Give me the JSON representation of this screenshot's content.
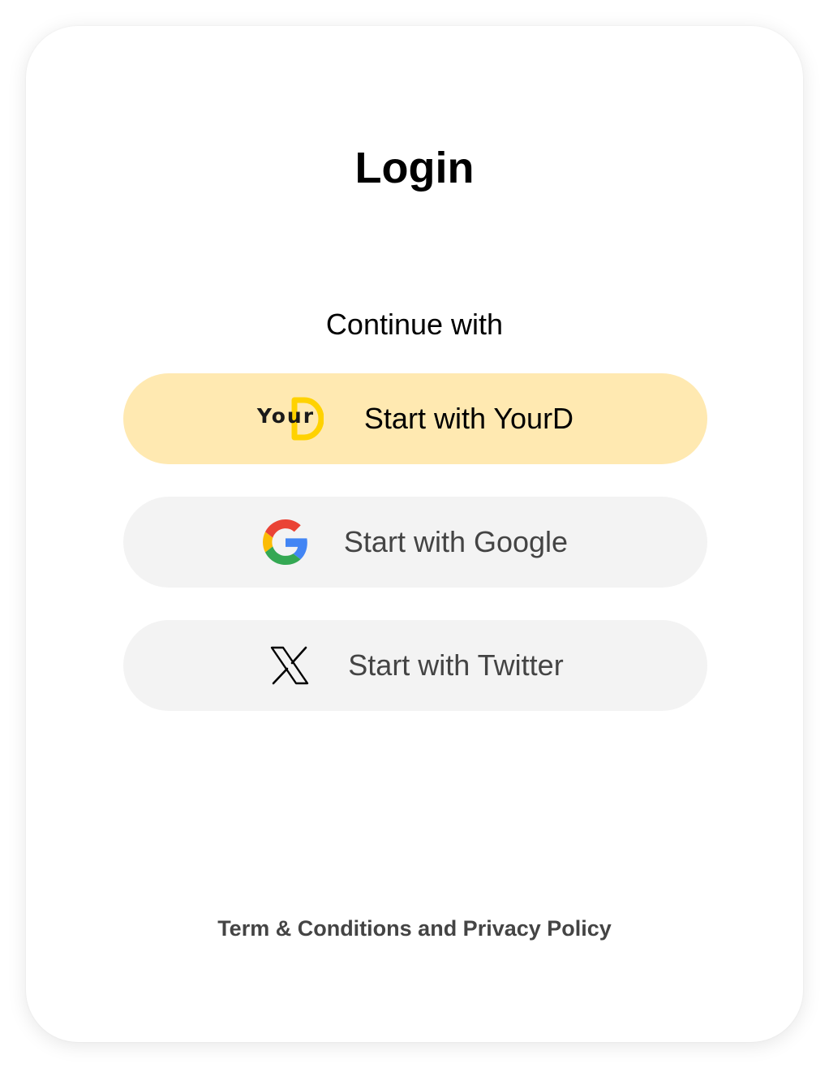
{
  "login": {
    "title": "Login",
    "subtitle": "Continue with"
  },
  "buttons": {
    "yourd": {
      "label": "Start with YourD",
      "logo_text": "Your",
      "icon": "yourd-logo",
      "background": "#ffe9b1",
      "accent": "#ffd200"
    },
    "google": {
      "label": "Start with Google",
      "icon": "google-icon",
      "background": "#f3f3f3"
    },
    "twitter": {
      "label": "Start with Twitter",
      "icon": "x-icon",
      "background": "#f3f3f3"
    }
  },
  "footer": {
    "terms_link": "Term & Conditions and Privacy Policy"
  }
}
